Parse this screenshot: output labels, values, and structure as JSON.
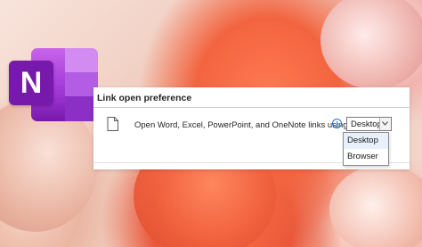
{
  "app": {
    "logo_letter": "N",
    "logo_icon": "onenote-logo-icon"
  },
  "panel": {
    "header": "Link open preference",
    "option_label": "Open Word, Excel, PowerPoint, and OneNote links using:",
    "info_icon": "info-icon",
    "doc_icon": "document-icon",
    "select": {
      "value": "Desktop",
      "arrow_icon": "chevron-down-icon"
    },
    "dropdown_options": [
      "Desktop",
      "Browser"
    ]
  },
  "colors": {
    "brand": "#7719aa",
    "accent": "#1e73c8"
  }
}
